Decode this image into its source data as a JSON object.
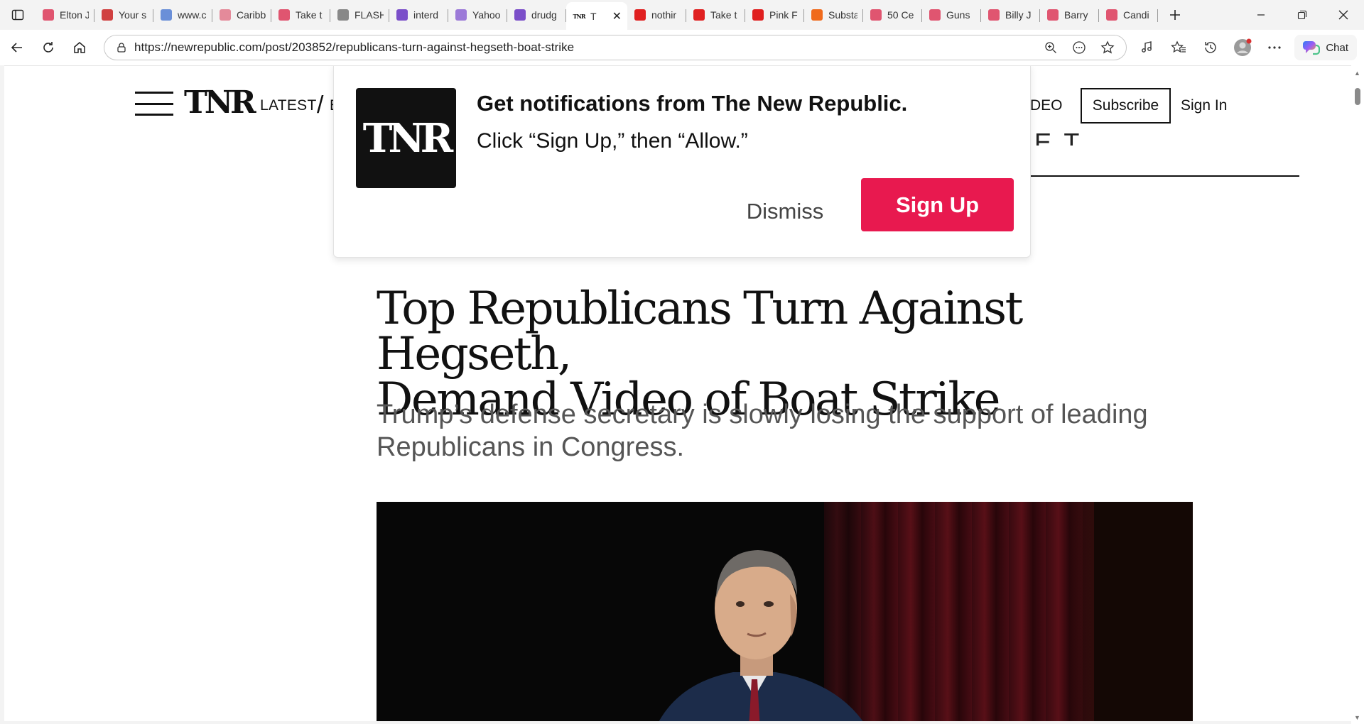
{
  "browser": {
    "tabs": [
      {
        "title": "Elton J",
        "favicon_color": "#e05570",
        "favicon": "video-icon"
      },
      {
        "title": "Your s",
        "favicon_color": "#d04040",
        "favicon": "pen-icon"
      },
      {
        "title": "www.c",
        "favicon_color": "#6a8fd8",
        "favicon": "search-icon"
      },
      {
        "title": "Caribb",
        "favicon_color": "#e48a9a",
        "favicon": "star-icon"
      },
      {
        "title": "Take t",
        "favicon_color": "#e05570",
        "favicon": "video-icon"
      },
      {
        "title": "FLASH",
        "favicon_color": "#888888",
        "favicon": "gp-icon"
      },
      {
        "title": "interd",
        "favicon_color": "#7b4fc9",
        "favicon": "yahoo-icon"
      },
      {
        "title": "Yahoo",
        "favicon_color": "#9c7ad8",
        "favicon": "quill-icon"
      },
      {
        "title": "drudg",
        "favicon_color": "#7b4fc9",
        "favicon": "yahoo-icon"
      },
      {
        "title": "T",
        "favicon_color": "#111111",
        "favicon": "tnr-icon",
        "active": true
      },
      {
        "title": "nothir",
        "favicon_color": "#e02020",
        "favicon": "youtube-icon"
      },
      {
        "title": "Take t",
        "favicon_color": "#e02020",
        "favicon": "youtube-icon"
      },
      {
        "title": "Pink F",
        "favicon_color": "#e02020",
        "favicon": "youtube-icon"
      },
      {
        "title": "Substa",
        "favicon_color": "#f06a1c",
        "favicon": "substack-icon"
      },
      {
        "title": "50 Ce",
        "favicon_color": "#e05570",
        "favicon": "video-icon"
      },
      {
        "title": "Guns",
        "favicon_color": "#e05570",
        "favicon": "video-icon"
      },
      {
        "title": "Billy J",
        "favicon_color": "#e05570",
        "favicon": "video-icon"
      },
      {
        "title": "Barry",
        "favicon_color": "#e05570",
        "favicon": "video-icon"
      },
      {
        "title": "Candi",
        "favicon_color": "#e05570",
        "favicon": "video-icon"
      }
    ],
    "url": "https://newrepublic.com/post/203852/republicans-turn-against-hegseth-boat-strike",
    "chat_label": "Chat"
  },
  "site": {
    "logo": "TNR",
    "nav_latest": "LATEST",
    "nav_slash": "/",
    "nav_cut": "E",
    "nav_video": "DEO",
    "subscribe": "Subscribe",
    "signin": "Sign In",
    "section_peek": "E T"
  },
  "notification": {
    "logo": "TNR",
    "title": "Get notifications from The New Republic.",
    "subtitle": "Click “Sign Up,” then “Allow.”",
    "dismiss": "Dismiss",
    "signup": "Sign Up",
    "accent": "#e8194f"
  },
  "article": {
    "headline_line1": "Top Republicans Turn Against Hegseth,",
    "headline_line2": "Demand Video of Boat Strike",
    "dek": "Trump’s defense secretary is slowly losing the support of leading Republicans in Congress."
  }
}
